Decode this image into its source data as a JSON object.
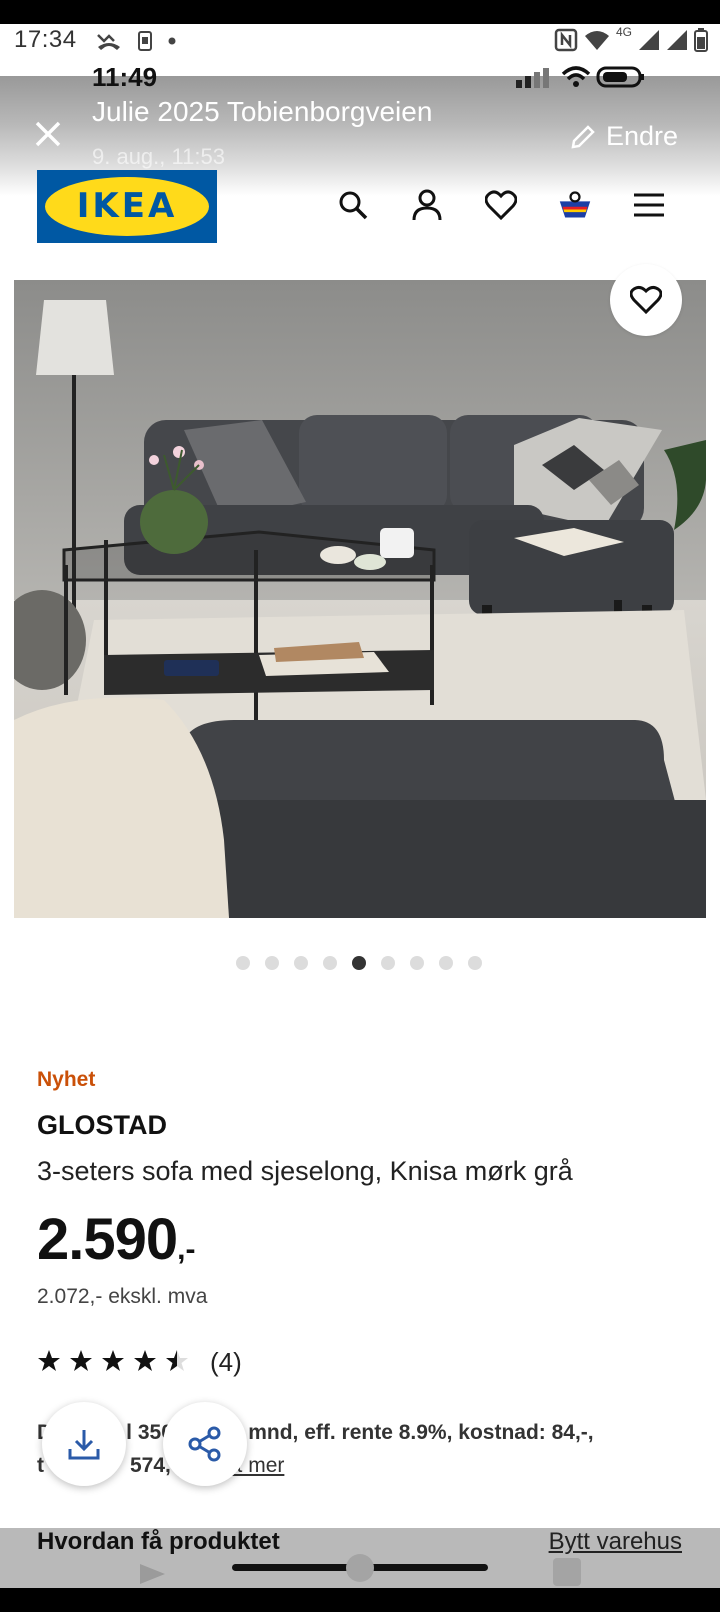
{
  "status_bar": {
    "time": "17:34",
    "network": "4G"
  },
  "overlay": {
    "time": "11:49",
    "title": "Julie 2025 Tobienborgveien",
    "subtitle": "9. aug., 11:53",
    "edit_label": "Endre"
  },
  "header": {
    "logo_text": "IKEA"
  },
  "gallery": {
    "dot_count": 9,
    "active_index": 4
  },
  "product": {
    "badge": "Nyhet",
    "name": "GLOSTAD",
    "description": "3-seters sofa med sjeselong, Knisa mørk grå",
    "price": "2.590",
    "price_suffix": ",-",
    "price_ex_vat": "2.072,- ekskl. mva",
    "rating": 4.5,
    "rating_count": "(4)"
  },
  "finance": {
    "line1_a": "D",
    "line1_b": "l 350",
    "line1_c": "' (8 mnd, eff. rente 8.9%, kostnad: 84,-,",
    "line2_a": "t",
    "line2_b": "574,-)",
    "link": "ut mer"
  },
  "delivery": {
    "heading": "Hvordan få produktet",
    "change_store": "Bytt varehus"
  },
  "colors": {
    "ikea_blue": "#0058a3",
    "ikea_yellow": "#ffda1a",
    "badge_orange": "#ca5008"
  }
}
